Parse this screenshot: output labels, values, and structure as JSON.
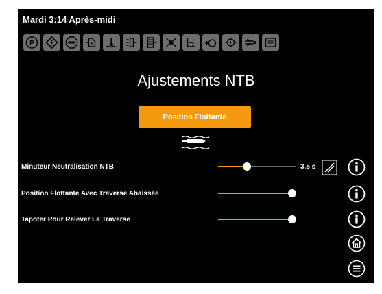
{
  "status": {
    "clock": "Mardi 3:14 Après-midi"
  },
  "toolbar_icons": [
    "parking-icon",
    "warning-icon",
    "stop-icon",
    "hydraulic-filter-icon",
    "water-temperature-icon",
    "fuel-filter-icon",
    "air-filter-icon",
    "transmission-icon",
    "coolant-level-icon",
    "oil-pressure-icon",
    "engine-oil-icon",
    "hitch-icon",
    "def-fluid-icon"
  ],
  "page": {
    "title": "Ajustements NTB"
  },
  "float_button": {
    "label": "Position Flottante"
  },
  "settings": [
    {
      "label": "Minuteur Neutralisation NTB",
      "value": "3.5 s",
      "slider_fraction": 0.35
    },
    {
      "label": "Position Flottante Avec Traverse Abaissée",
      "slider_fraction": 1.0
    },
    {
      "label": "Tapoter Pour Relever La Traverse",
      "slider_fraction": 1.0
    }
  ],
  "colors": {
    "accent": "#f59a0e",
    "background": "#000000",
    "icon_tile": "#6d6d6d"
  }
}
